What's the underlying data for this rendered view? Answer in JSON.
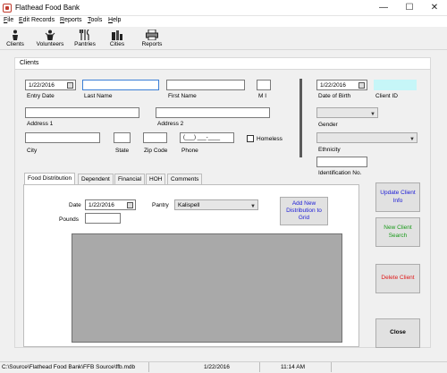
{
  "window": {
    "title": "Flathead Food Bank",
    "minimize": "—",
    "maximize": "☐",
    "close": "✕"
  },
  "menu": [
    {
      "label": "File",
      "underline": "F",
      "rest": "ile"
    },
    {
      "label": "Edit Records",
      "underline": "E",
      "rest": "dit Records"
    },
    {
      "label": "Reports",
      "underline": "R",
      "rest": "eports"
    },
    {
      "label": "Tools",
      "underline": "T",
      "rest": "ools"
    },
    {
      "label": "Help",
      "underline": "H",
      "rest": "elp"
    }
  ],
  "toolbar": {
    "clients": "Clients",
    "volunteers": "Volunteers",
    "pantries": "Pantries",
    "cities": "Cities",
    "reports": "Reports"
  },
  "panel": {
    "title": "Clients"
  },
  "form": {
    "entry_date_value": "1/22/2016",
    "entry_date_label": "Entry Date",
    "last_name_label": "Last Name",
    "first_name_label": "First Name",
    "mi_label": "M I",
    "address1_label": "Address 1",
    "address2_label": "Address 2",
    "city_label": "City",
    "state_label": "State",
    "zip_label": "Zip Code",
    "phone_label": "Phone",
    "phone_mask": "(___) ___-____",
    "homeless_label": "Homeless",
    "dob_value": "1/22/2016",
    "dob_label": "Date of Birth",
    "client_id_label": "Client ID",
    "gender_label": "Gender",
    "ethnicity_label": "Ethnicity",
    "id_no_label": "Identification No."
  },
  "tabs": [
    "Food Distribution",
    "Dependent",
    "Financial",
    "HOH",
    "Comments"
  ],
  "distribution": {
    "date_label": "Date",
    "date_value": "1/22/2016",
    "pantry_label": "Pantry",
    "pantry_value": "Kalispell",
    "pounds_label": "Pounds",
    "add_button": "Add New Distribution to Grid"
  },
  "buttons": {
    "update": "Update Client Info",
    "new_search": "New Client Search",
    "delete": "Delete Client",
    "close": "Close"
  },
  "status": {
    "path": "C:\\Source\\Flathead Food Bank\\FFB Source\\ffb.mdb",
    "date": "1/22/2016",
    "time": "11:14 AM"
  },
  "colors": {
    "client_id_bg": "#c6f6f8",
    "focus_border": "#3c7fd6"
  }
}
